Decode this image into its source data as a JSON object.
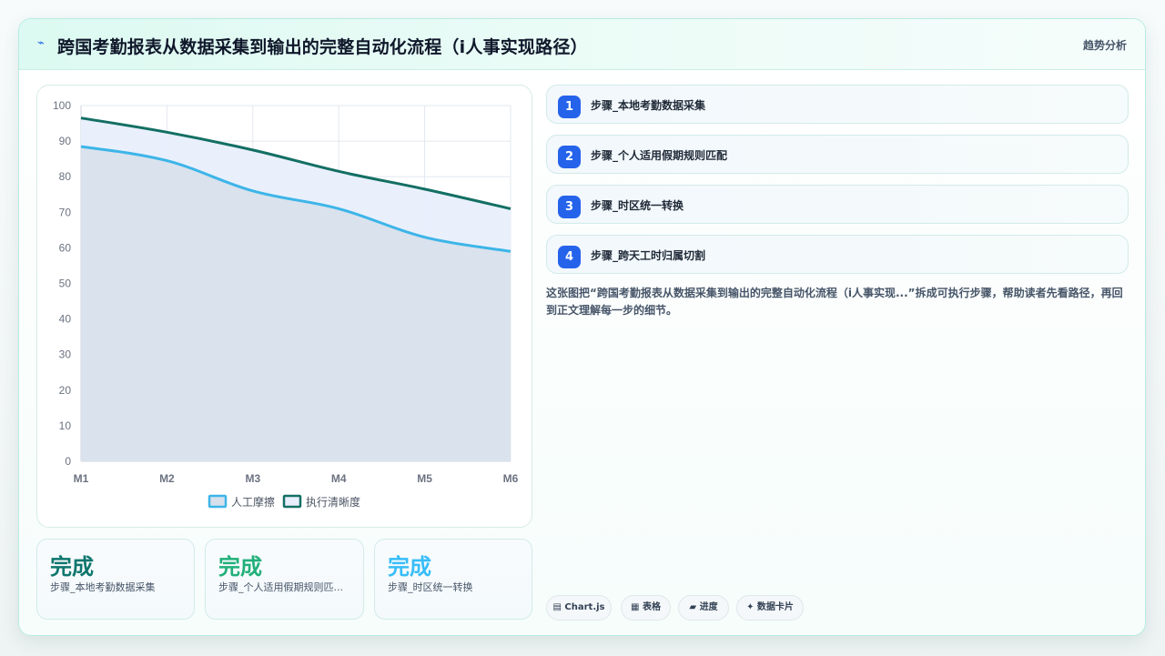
{
  "header": {
    "icon": "pulse-icon",
    "title": "跨国考勤报表从数据采集到输出的完整自动化流程（i人事实现路径）",
    "action": "趋势分析"
  },
  "steps": [
    {
      "num": "1",
      "label": "步骤_本地考勤数据采集"
    },
    {
      "num": "2",
      "label": "步骤_个人适用假期规则匹配"
    },
    {
      "num": "3",
      "label": "步骤_时区统一转换"
    },
    {
      "num": "4",
      "label": "步骤_跨天工时归属切割"
    }
  ],
  "description": "这张图把“跨国考勤报表从数据采集到输出的完整自动化流程（i人事实现...”拆成可执行步骤，帮助读者先看路径，再回到正文理解每一步的细节。",
  "metrics": [
    {
      "value": "完成",
      "label": "步骤_本地考勤数据采集",
      "color": "#0f766e"
    },
    {
      "value": "完成",
      "label": "步骤_个人适用假期规则匹...",
      "color": "#22b07a"
    },
    {
      "value": "完成",
      "label": "步骤_时区统一转换",
      "color": "#38bdf8"
    }
  ],
  "tags": [
    {
      "icon": "chart-icon",
      "label": "▤ Chart.js"
    },
    {
      "icon": "table-icon",
      "label": "▦ 表格"
    },
    {
      "icon": "progress-icon",
      "label": "▰ 进度"
    },
    {
      "icon": "sparkle-icon",
      "label": "✦ 数据卡片"
    }
  ],
  "chart_data": {
    "type": "area",
    "x": [
      "M1",
      "M2",
      "M3",
      "M4",
      "M5",
      "M6"
    ],
    "ylim": [
      0,
      100
    ],
    "yticks": [
      0,
      10,
      20,
      30,
      40,
      50,
      60,
      70,
      80,
      90,
      100
    ],
    "grid": true,
    "legend_position": "bottom",
    "series": [
      {
        "name": "人工摩擦",
        "values": [
          88.5,
          84.5,
          76,
          71,
          63,
          59
        ],
        "color": "#3db5e8",
        "fill": "#d8e0ec"
      },
      {
        "name": "执行清晰度",
        "values": [
          96.5,
          92.5,
          87.5,
          81.5,
          76.5,
          71
        ],
        "color": "#136f63",
        "fill": "#e8effc"
      }
    ]
  }
}
